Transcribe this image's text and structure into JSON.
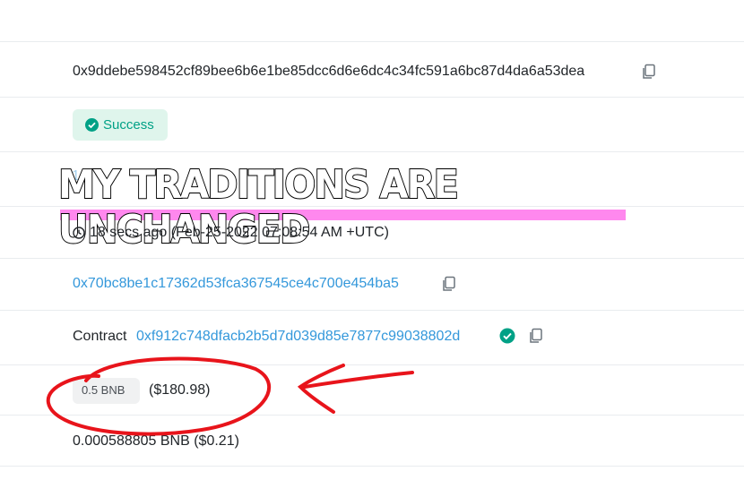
{
  "tx_hash": "0x9ddebe598452cf89bee6b6e1be85dcc6d6e6dc4c34fc591a6bc87d4da6a53dea",
  "status": "Success",
  "block_faded": "1",
  "timestamp": "18 secs ago (Feb-25-2022 07:08:54 AM +UTC)",
  "from_address": "0x70bc8be1c17362d53fca367545ce4c700e454ba5",
  "to_prefix": "Contract",
  "to_address": "0xf912c748dfacb2b5d7d039d85e7877c99038802d",
  "value_amount": "0.5 BNB",
  "value_usd": "($180.98)",
  "fee": "0.000588805 BNB ($0.21)",
  "meme_caption": "MY TRADITIONS ARE UNCHANGED",
  "colors": {
    "link": "#3498db",
    "success_bg": "#dff5ec",
    "success_text": "#00a186",
    "annotation_red": "#e8141b",
    "caption_bar": "#ff88ee"
  }
}
